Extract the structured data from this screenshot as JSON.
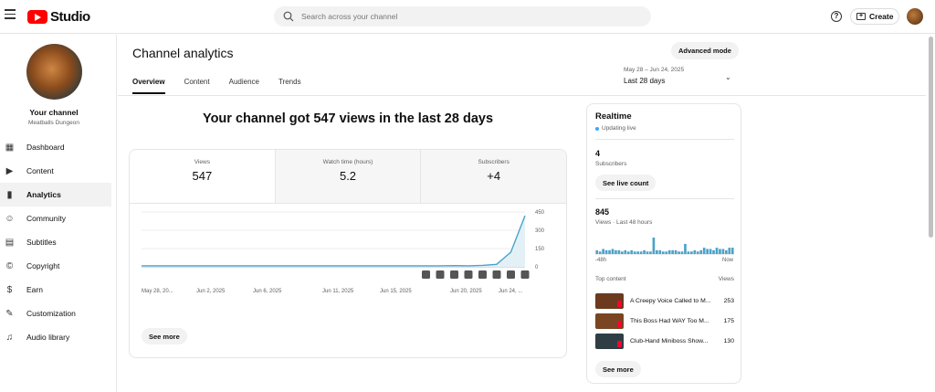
{
  "app": {
    "logo_text": "Studio"
  },
  "search": {
    "placeholder": "Search across your channel"
  },
  "header": {
    "create_label": "Create",
    "help_icon": "?"
  },
  "channel": {
    "title": "Your channel",
    "name": "Meatballs Dungeon"
  },
  "sidebar": {
    "items": [
      {
        "label": "Dashboard",
        "icon": "dashboard-icon",
        "glyph": "▦"
      },
      {
        "label": "Content",
        "icon": "content-icon",
        "glyph": "▶"
      },
      {
        "label": "Analytics",
        "icon": "analytics-icon",
        "glyph": "▮"
      },
      {
        "label": "Community",
        "icon": "community-icon",
        "glyph": "☺"
      },
      {
        "label": "Subtitles",
        "icon": "subtitles-icon",
        "glyph": "▤"
      },
      {
        "label": "Copyright",
        "icon": "copyright-icon",
        "glyph": "©"
      },
      {
        "label": "Earn",
        "icon": "earn-icon",
        "glyph": "$"
      },
      {
        "label": "Customization",
        "icon": "customization-icon",
        "glyph": "✎"
      },
      {
        "label": "Audio library",
        "icon": "audio-library-icon",
        "glyph": "♫"
      }
    ],
    "active_index": 2
  },
  "page": {
    "title": "Channel analytics",
    "advanced_mode": "Advanced mode",
    "tabs": [
      "Overview",
      "Content",
      "Audience",
      "Trends"
    ],
    "date_range_dates": "May 28 – Jun 24, 2025",
    "date_range_label": "Last 28 days",
    "headline": "Your channel got 547 views in the last 28 days"
  },
  "metrics": [
    {
      "label": "Views",
      "value": "547"
    },
    {
      "label": "Watch time (hours)",
      "value": "5.2"
    },
    {
      "label": "Subscribers",
      "value": "+4"
    }
  ],
  "see_more": "See more",
  "chart_data": {
    "type": "area",
    "series": [
      {
        "values": [
          8,
          8,
          8,
          8,
          8,
          8,
          8,
          8,
          8,
          8,
          8,
          8,
          8,
          8,
          8,
          8,
          8,
          8,
          8,
          8,
          8,
          8,
          10,
          8,
          12,
          20,
          120,
          420
        ]
      }
    ],
    "x_tick_labels": [
      "May 28, 20...",
      "Jun 2, 2025",
      "Jun 6, 2025",
      "Jun 11, 2025",
      "Jun 15, 2025",
      "Jun 20, 2025",
      "Jun 24, ..."
    ],
    "y_tick_labels": [
      "450",
      "300",
      "150",
      "0"
    ],
    "ylim": [
      0,
      450
    ],
    "grid": true,
    "color": "#4aa3c9"
  },
  "realtime": {
    "title": "Realtime",
    "status": "Updating live",
    "subscribers": "4",
    "subscribers_label": "Subscribers",
    "see_live_count": "See live count",
    "views": "845",
    "views_label": "Views · Last 48 hours",
    "axis_start": "-48h",
    "axis_end": "Now",
    "bar_values": [
      3,
      2,
      4,
      3,
      3,
      4,
      3,
      3,
      2,
      3,
      2,
      3,
      2,
      2,
      2,
      3,
      2,
      2,
      13,
      3,
      3,
      2,
      2,
      3,
      3,
      3,
      2,
      2,
      8,
      2,
      2,
      3,
      2,
      3,
      5,
      4,
      4,
      3,
      5,
      4,
      4,
      3,
      5,
      5
    ],
    "top_content_label": "Top content",
    "top_content_metric": "Views",
    "top_content": [
      {
        "title": "A Creepy Voice Called to M...",
        "views": "253",
        "color": "#6b3a1f"
      },
      {
        "title": "This Boss Had WAY Too M...",
        "views": "175",
        "color": "#7a4522"
      },
      {
        "title": "Club-Hand Miniboss Show...",
        "views": "130",
        "color": "#2e3e44"
      }
    ],
    "see_more": "See more"
  }
}
